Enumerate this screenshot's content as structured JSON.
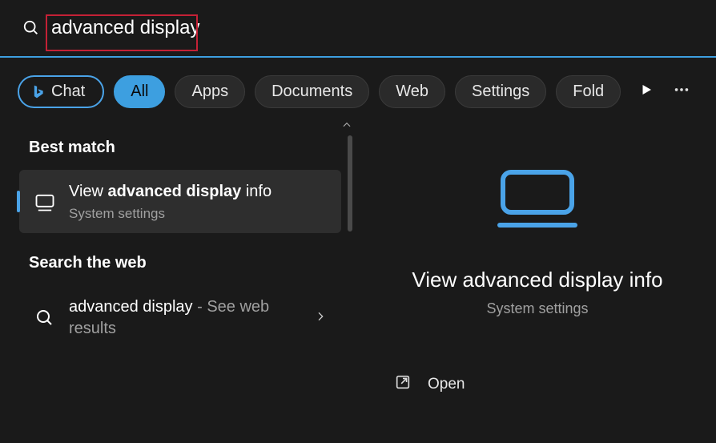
{
  "search": {
    "value": "advanced display",
    "chat_label": "Chat",
    "filters": [
      "All",
      "Apps",
      "Documents",
      "Web",
      "Settings",
      "Fold"
    ]
  },
  "left": {
    "best_match_title": "Best match",
    "best_match": {
      "title_prefix": "View ",
      "title_bold": "advanced display",
      "title_suffix": " info",
      "subtitle": "System settings"
    },
    "web_title": "Search the web",
    "web": {
      "query": "advanced display",
      "suffix": " - See web results"
    }
  },
  "detail": {
    "title": "View advanced display info",
    "subtitle": "System settings",
    "open_label": "Open"
  }
}
